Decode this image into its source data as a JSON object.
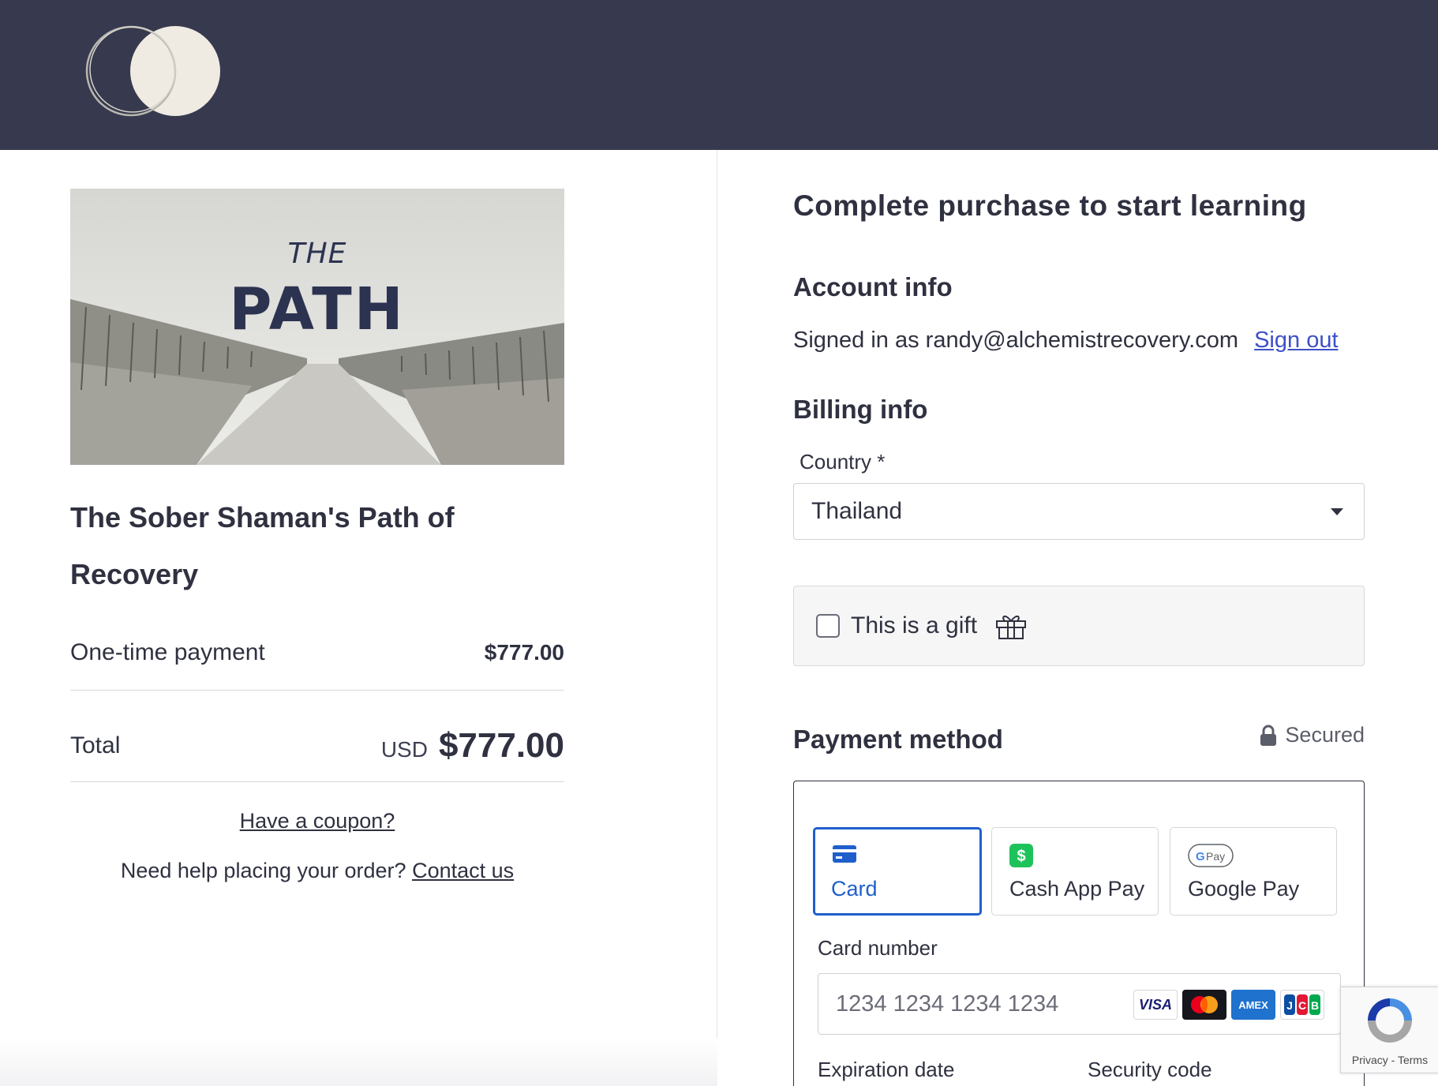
{
  "header": {
    "logo_icon": "overlapping-circles-logo",
    "bg_color": "#373a4e"
  },
  "product": {
    "image_title_small": "THE",
    "image_title_big": "PATH",
    "title": "The Sober Shaman's Path of Recovery"
  },
  "summary": {
    "onetime_label": "One-time payment",
    "onetime_amount": "$777.00",
    "total_label": "Total",
    "total_currency": "USD",
    "total_amount": "$777.00",
    "coupon_link": "Have a coupon?",
    "help_text": "Need help placing your order?",
    "contact_link": "Contact us"
  },
  "checkout": {
    "heading": "Complete purchase to start learning",
    "account_heading": "Account info",
    "signed_in_text": "Signed in as randy@alchemistrecovery.com",
    "sign_out": "Sign out",
    "billing_heading": "Billing info",
    "country_label": "Country *",
    "country_value": "Thailand",
    "gift_label": "This is a gift",
    "gift_checked": false,
    "payment_heading": "Payment method",
    "secured_label": "Secured",
    "tabs": [
      {
        "label": "Card",
        "icon": "credit-card-icon",
        "active": true
      },
      {
        "label": "Cash App Pay",
        "icon": "cash-app-icon",
        "active": false
      },
      {
        "label": "Google Pay",
        "icon": "google-pay-icon",
        "active": false
      }
    ],
    "card_number_label": "Card number",
    "card_number_placeholder": "1234 1234 1234 1234",
    "card_brands": [
      "VISA",
      "mastercard",
      "AMEX",
      "JCB"
    ],
    "expiration_label": "Expiration date",
    "security_label": "Security code",
    "accent_color": "#1f5fcc",
    "link_color": "#3d50c7"
  },
  "recaptcha": {
    "terms_text": "Privacy - Terms"
  }
}
